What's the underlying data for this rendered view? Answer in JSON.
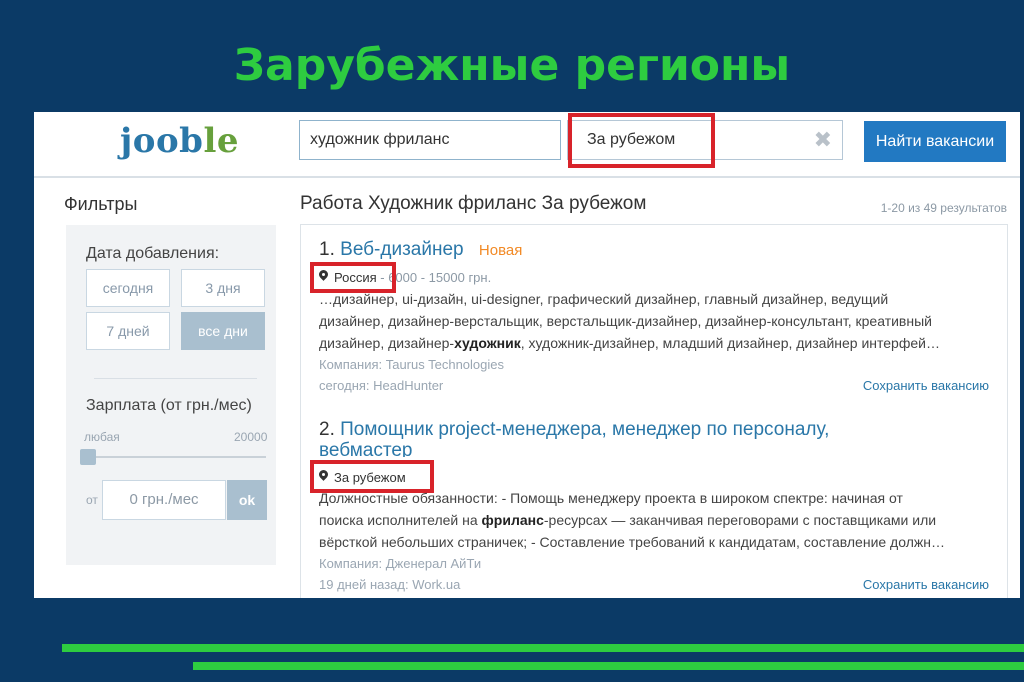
{
  "slide": {
    "title": "Зарубежные регионы"
  },
  "header": {
    "logo_jo": "jo",
    "logo_ob": "ob",
    "logo_le": "le",
    "query_value": "художник фриланс",
    "location_value": "За рубежом",
    "clear_icon": "✖",
    "find_button": "Найти вакансии"
  },
  "filters": {
    "title": "Фильтры",
    "date_label": "Дата добавления:",
    "date_options": [
      "сегодня",
      "3 дня",
      "7 дней",
      "все дни"
    ],
    "selected_date": "все дни",
    "salary_label": "Зарплата (от грн./мес)",
    "salary_min_label": "любая",
    "salary_max_label": "20000",
    "salary_from_label": "от",
    "salary_placeholder": "0 грн./мес",
    "ok_button": "ok",
    "slider_value": 0
  },
  "results": {
    "title": "Работа Художник фриланс За рубежом",
    "count": "1-20 из 49 результатов",
    "jobs": [
      {
        "num": "1.",
        "title": "Веб-дизайнер",
        "badge": "Новая",
        "location": "Россия",
        "salary": "6000 - 15000 грн.",
        "desc_line1": "…дизайнер, ui-дизайн, ui-designer, графический дизайнер, главный дизайнер, ведущий",
        "desc_line2": "дизайнер, дизайнер-верстальщик, верстальщик-дизайнер, дизайнер-консультант, креативный",
        "desc_line3_a": "дизайнер, дизайнер-",
        "desc_line3_b": "художник",
        "desc_line3_c": ", художник-дизайнер, младший дизайнер, дизайнер интерфей…",
        "company": "Компания: Taurus Technologies",
        "source": "сегодня: HeadHunter",
        "save": "Сохранить вакансию"
      },
      {
        "num": "2.",
        "title": "Помощник project-менеджера, менеджер по персоналу,",
        "title_line2": "вебмастер",
        "location": "За рубежом",
        "desc_line1": "Должностные обязанности: - Помощь менеджеру проекта в широком спектре: начиная от",
        "desc_line2_a": "поиска исполнителей на ",
        "desc_line2_b": "фриланс",
        "desc_line2_c": "-ресурсах — заканчивая переговорами с поставщиками или",
        "desc_line3": "вёрсткой небольших страничек; - Составление требований к кандидатам, составление должн…",
        "company": "Компания: Дженерал АйТи",
        "source": "19 дней назад: Work.ua",
        "save": "Сохранить вакансию"
      }
    ]
  },
  "colors": {
    "slide_background": "#0b3a66",
    "title_green": "#2ecc40",
    "highlight_red": "#d8232a",
    "button_blue": "#2279c2",
    "link_blue": "#2a77a8",
    "new_badge_orange": "#f28a26"
  }
}
